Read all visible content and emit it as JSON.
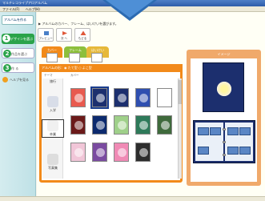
{
  "app": {
    "title": "マルチレコライプアロアルバム",
    "menu": [
      "ファイル(F)",
      "ヘルプ(H)"
    ]
  },
  "sidebar": {
    "top_button": "アルバムを作る",
    "steps": [
      {
        "num": "1",
        "label": "デザインを選ぶ"
      },
      {
        "num": "2",
        "label": "作品を選ぶ"
      },
      {
        "num": "3",
        "label": "作 る"
      }
    ],
    "help": "ヘルプを見る"
  },
  "main": {
    "breadcrumb": "▶ アルバムのカバー、フレーム、はいけいを選びます。",
    "toolbar": [
      {
        "label": "プレビュー",
        "icon": "preview-icon"
      },
      {
        "label": "次 へ",
        "icon": "next-icon"
      },
      {
        "label": "もどる",
        "icon": "back-icon"
      }
    ],
    "tabs": [
      {
        "label": "カバー"
      },
      {
        "label": "フレーム"
      },
      {
        "label": "はいけい"
      }
    ],
    "panel_header": "アルバムの形：◉ たて型 ○ よこ型",
    "col_theme": "テーマ",
    "col_cover": "カバー",
    "themes": [
      {
        "label": "旅行",
        "color": "#f5f5f5"
      },
      {
        "label": "入学",
        "color": "#e2e6ef"
      },
      {
        "label": "卒業",
        "color": "#ffffff"
      },
      {
        "label": "写真集",
        "color": "#e8e8e8"
      }
    ],
    "covers_colors": [
      "#e85a4f",
      "#1c2f6e",
      "#1c2f6e",
      "#2f4fb0",
      "#6b1a1a",
      "#0c2a6e",
      "#9fd08a",
      "#2e7a5a",
      "#3f6a3c",
      "#ffffff",
      "#f1c6d8",
      "#7a4ba0",
      "#f08ab5",
      "#2d2d2d"
    ]
  },
  "preview": {
    "title": "イメージ"
  },
  "colors": {
    "accent": "#f28a1a",
    "step_green": "#2aa34a",
    "cover_navy": "#1c2f6e"
  }
}
